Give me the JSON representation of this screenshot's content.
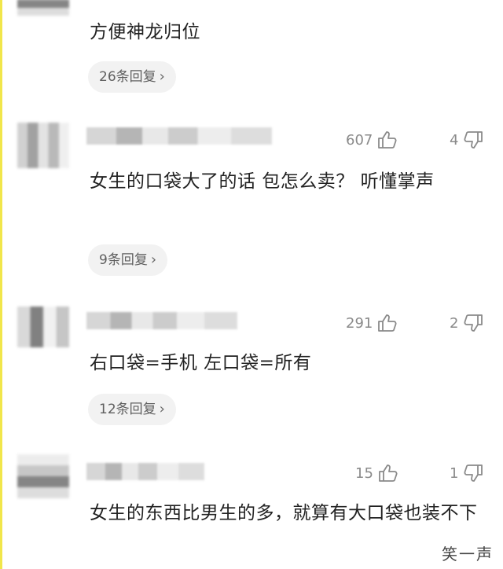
{
  "comments": [
    {
      "text": "方便神龙归位",
      "replies": "26条回复",
      "likes": null,
      "dislikes": null
    },
    {
      "text": "女生的口袋大了的话  包怎么卖？  听懂掌声",
      "replies": "9条回复",
      "likes": "607",
      "dislikes": "4"
    },
    {
      "text": "右口袋=手机  左口袋=所有",
      "replies": "12条回复",
      "likes": "291",
      "dislikes": "2"
    },
    {
      "text": "女生的东西比男生的多，就算有大口袋也装不下",
      "replies": null,
      "likes": "15",
      "dislikes": "1"
    }
  ],
  "icons": {
    "thumb_up": "thumbs-up-icon",
    "thumb_down": "thumbs-down-icon",
    "chevron": "chevron-right-icon"
  },
  "watermark": "笑一声",
  "colors": {
    "accent_line": "#f1e64b",
    "pill_bg": "#f2f2f2",
    "meta": "#8a8a8a"
  }
}
